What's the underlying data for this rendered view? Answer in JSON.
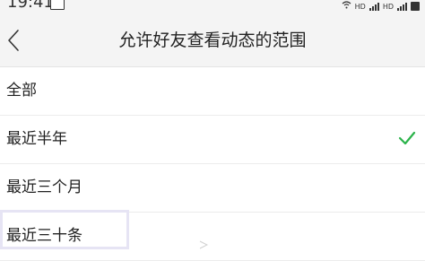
{
  "status_bar": {
    "time": "19:41",
    "icons": [
      "image-icon",
      "wifi-icon",
      "hd-signal-icon",
      "hd-signal-icon",
      "battery-icon"
    ],
    "hd_label": "HD"
  },
  "header": {
    "title": "允许好友查看动态的范围",
    "back_icon": "chevron-left-icon"
  },
  "options": [
    {
      "label": "全部",
      "selected": false
    },
    {
      "label": "最近半年",
      "selected": true
    },
    {
      "label": "最近三个月",
      "selected": false
    },
    {
      "label": "最近三十条",
      "selected": false
    }
  ],
  "colors": {
    "check": "#2bb34a",
    "header_bg": "#f4f4f4"
  }
}
